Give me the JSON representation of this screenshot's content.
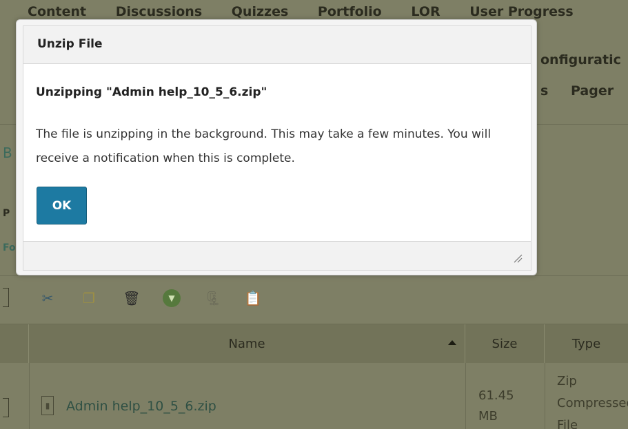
{
  "background_page": {
    "nav_top_items": [
      "Content",
      "Discussions",
      "Quizzes",
      "Portfolio",
      "LOR",
      "User Progress"
    ],
    "nav_row2_fragment": "onfiguratic",
    "nav_row3_s": "s",
    "nav_row3_pager": "Pager",
    "side_fragments": [
      "B",
      "P",
      "Fo"
    ],
    "toolbar_icons": [
      "cut-icon",
      "copy-icon",
      "delete-icon",
      "more-actions-icon",
      "zip-icon",
      "paste-icon"
    ],
    "table": {
      "headers": {
        "name": "Name",
        "size": "Size",
        "type": "Type"
      },
      "rows": [
        {
          "name": "Admin help_10_5_6.zip",
          "size": "61.45 MB",
          "type": "Zip Compressed File"
        }
      ]
    }
  },
  "dialog": {
    "title": "Unzip File",
    "heading": "Unzipping \"Admin help_10_5_6.zip\"",
    "message": "The file is unzipping in the background. This may take a few minutes. You will receive a notification when this is complete.",
    "ok_label": "OK"
  },
  "colors": {
    "overlay_background": "#7e7f65",
    "ok_button": "#1d7aa2",
    "link_teal": "#2f5044"
  }
}
